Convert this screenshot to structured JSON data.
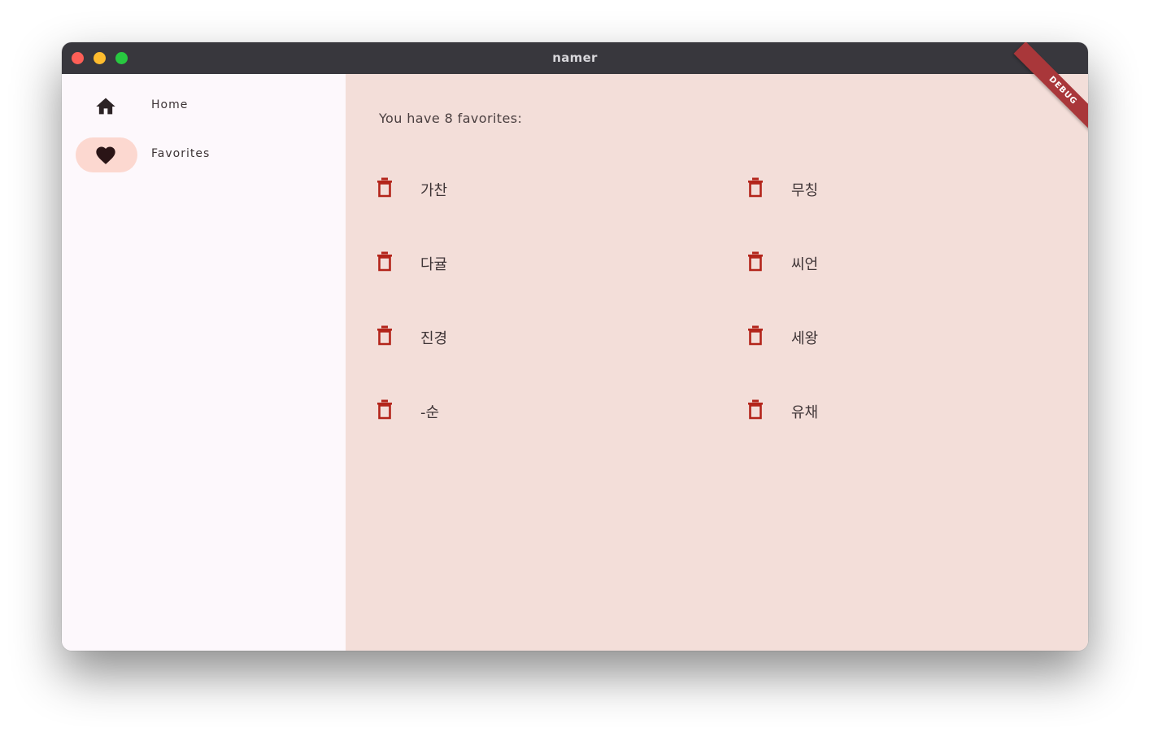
{
  "window": {
    "title": "namer",
    "debug_banner": "DEBUG"
  },
  "sidebar": {
    "items": [
      {
        "label": "Home",
        "icon": "home-icon",
        "selected": false
      },
      {
        "label": "Favorites",
        "icon": "heart-icon",
        "selected": true
      }
    ]
  },
  "main": {
    "count_text": "You have 8 favorites:",
    "favorites": [
      {
        "name": "가찬",
        "icon": "trash-icon"
      },
      {
        "name": "무칭",
        "icon": "trash-icon"
      },
      {
        "name": "다귤",
        "icon": "trash-icon"
      },
      {
        "name": "씨언",
        "icon": "trash-icon"
      },
      {
        "name": "진경",
        "icon": "trash-icon"
      },
      {
        "name": "세왕",
        "icon": "trash-icon"
      },
      {
        "name": "-순",
        "icon": "trash-icon"
      },
      {
        "name": "유채",
        "icon": "trash-icon"
      }
    ]
  },
  "colors": {
    "titlebar": "#38373d",
    "sidebar_bg": "#fdf8fc",
    "main_bg": "#f3ded9",
    "selected_indicator": "#fcd8d0",
    "trash_icon": "#b3241a",
    "debug_banner": "#a9373a"
  }
}
